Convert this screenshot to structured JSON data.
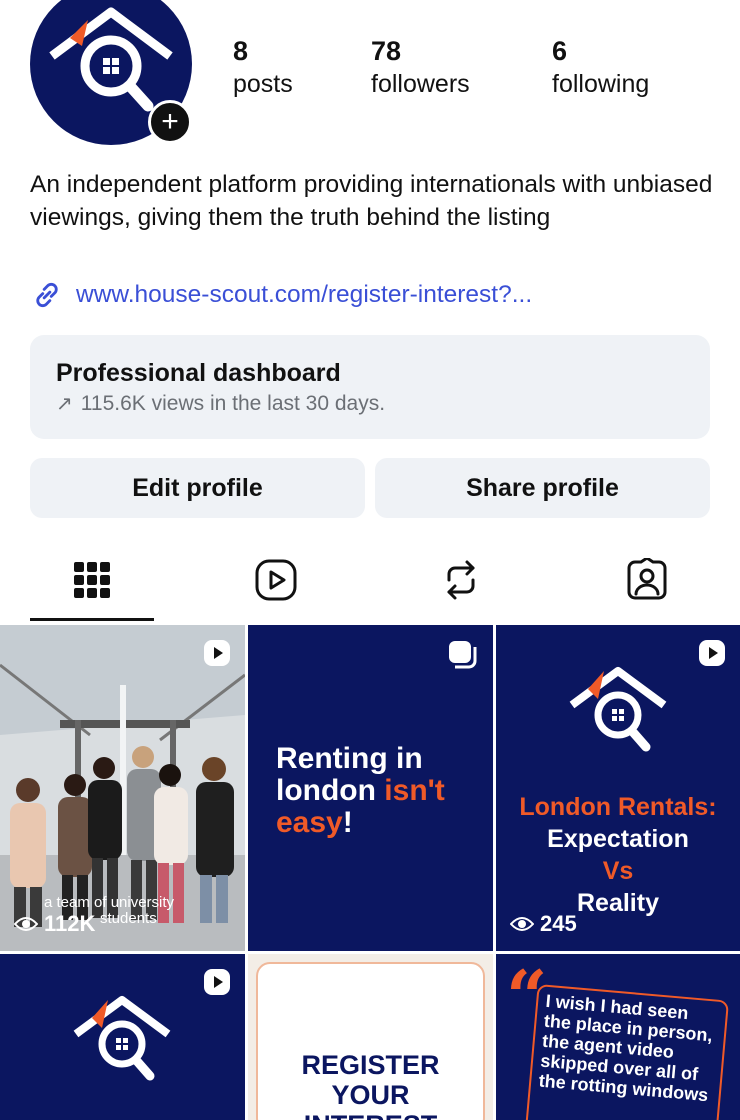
{
  "profile": {
    "stats": [
      {
        "value": "8",
        "label": "posts"
      },
      {
        "value": "78",
        "label": "followers"
      },
      {
        "value": "6",
        "label": "following"
      }
    ],
    "bio": "An independent platform providing internationals with unbiased viewings, giving them the truth behind the listing",
    "link": "www.house-scout.com/register-interest?..."
  },
  "dashboard": {
    "title": "Professional dashboard",
    "subtitle": "115.6K views in the last 30 days."
  },
  "buttons": {
    "edit": "Edit profile",
    "share": "Share profile"
  },
  "tabs": {
    "icons": [
      "grid-icon",
      "reels-icon",
      "reposts-icon",
      "tagged-icon"
    ],
    "active": "grid-icon"
  },
  "posts": [
    {
      "views": "112K",
      "caption": "a team of university students"
    },
    {
      "line1": "Renting in",
      "line2a": "london ",
      "line2b": "isn't",
      "line3a": "easy",
      "line3b": "!"
    },
    {
      "title": "London Rentals:",
      "line2": "Expectation",
      "line3": "Vs",
      "line4": "Reality",
      "views": "245"
    },
    {},
    {
      "line1": "REGISTER",
      "line2": "YOUR",
      "line3": "INTEREST"
    },
    {
      "quote": "I wish I had seen the place in person, the agent video skipped over all of the rotting windows"
    }
  ],
  "colors": {
    "brand_navy": "#0b1660",
    "brand_orange": "#f05a28",
    "link_blue": "#3a4fd6",
    "card_bg": "#eff2f6"
  }
}
